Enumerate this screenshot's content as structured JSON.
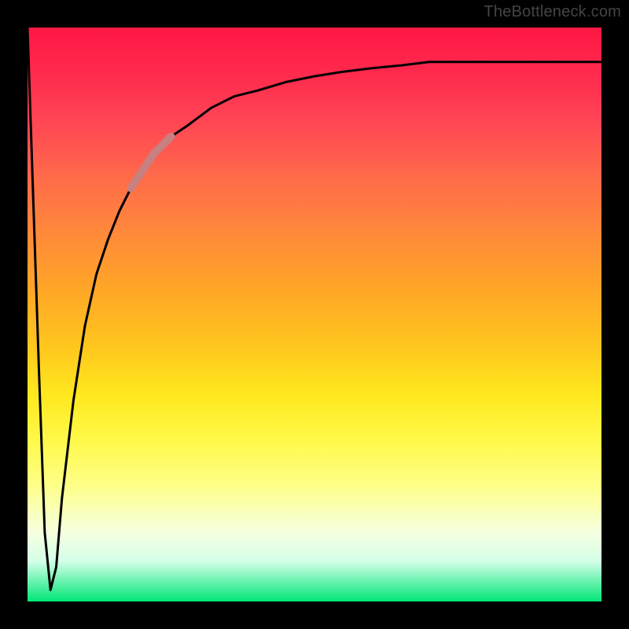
{
  "watermark": "TheBottleneck.com",
  "chart_data": {
    "type": "line",
    "title": "",
    "xlabel": "",
    "ylabel": "",
    "xlim": [
      0,
      100
    ],
    "ylim": [
      0,
      100
    ],
    "grid": false,
    "legend": false,
    "series": [
      {
        "name": "curve",
        "x": [
          0,
          1,
          2,
          3,
          4,
          5,
          6,
          8,
          10,
          12,
          14,
          16,
          18,
          20,
          22,
          25,
          28,
          32,
          36,
          40,
          45,
          50,
          55,
          60,
          65,
          70,
          75,
          80,
          85,
          90,
          95,
          100
        ],
        "y": [
          100,
          70,
          40,
          12,
          2,
          6,
          18,
          35,
          48,
          57,
          63,
          68,
          72,
          75,
          78,
          81,
          83,
          86,
          88,
          89,
          90.5,
          91.5,
          92.3,
          92.9,
          93.4,
          94,
          94,
          94,
          94,
          94,
          94,
          94
        ]
      }
    ],
    "highlight": {
      "x_range": [
        18,
        25
      ],
      "note": "faded salmon segment on rising curve"
    },
    "background_gradient": [
      "#ff1744",
      "#ffa726",
      "#fff94a",
      "#00e676"
    ]
  }
}
